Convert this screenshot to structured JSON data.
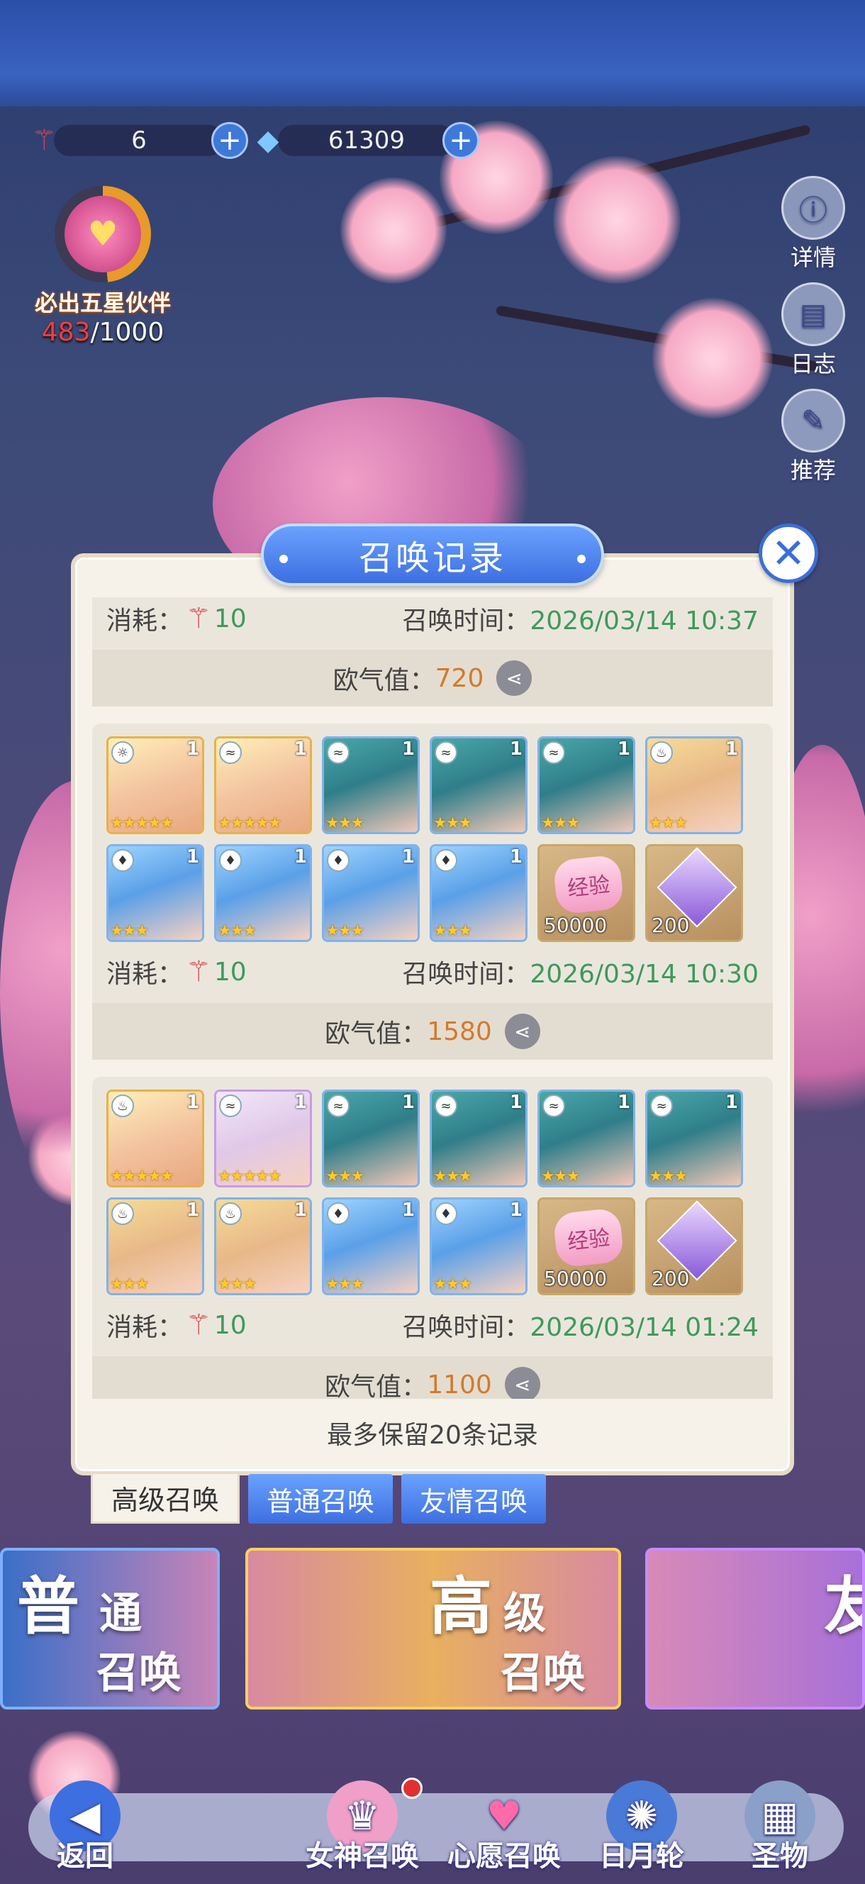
{
  "resources": {
    "summon_ticket": {
      "icon": "summon-wand-icon",
      "value": "6"
    },
    "crystal": {
      "icon": "crystal-icon",
      "value": "61309"
    }
  },
  "pity": {
    "label": "必出五星伙伴",
    "current": "483",
    "separator": "/",
    "total": "1000",
    "progress_fraction": 0.483
  },
  "side_menu": [
    {
      "label": "详情",
      "icon": "info-icon"
    },
    {
      "label": "日志",
      "icon": "book-icon"
    },
    {
      "label": "推荐",
      "icon": "feather-icon"
    }
  ],
  "modal": {
    "title": "召唤记录",
    "close_icon": "close-icon",
    "footer_note": "最多保留20条记录",
    "labels": {
      "cost": "消耗：",
      "time": "召唤时间：",
      "luck": "欧气值："
    },
    "records": [
      {
        "cost": "10",
        "time": "2026/03/14 10:37",
        "luck": "720",
        "cards": []
      },
      {
        "cost": "10",
        "time": "2026/03/14 10:30",
        "luck": "1580",
        "cards": [
          {
            "type": "hero",
            "count": "1",
            "stars": 5,
            "element": "light",
            "tone": "gold"
          },
          {
            "type": "hero",
            "count": "1",
            "stars": 5,
            "element": "wind",
            "tone": "gold"
          },
          {
            "type": "hero",
            "count": "1",
            "stars": 3,
            "element": "wind",
            "tone": "teal"
          },
          {
            "type": "hero",
            "count": "1",
            "stars": 3,
            "element": "wind",
            "tone": "teal"
          },
          {
            "type": "hero",
            "count": "1",
            "stars": 3,
            "element": "wind",
            "tone": "teal"
          },
          {
            "type": "hero",
            "count": "1",
            "stars": 3,
            "element": "fire",
            "tone": "blonde"
          },
          {
            "type": "hero",
            "count": "1",
            "stars": 3,
            "element": "water",
            "tone": "blue"
          },
          {
            "type": "hero",
            "count": "1",
            "stars": 3,
            "element": "water",
            "tone": "blue"
          },
          {
            "type": "hero",
            "count": "1",
            "stars": 3,
            "element": "water",
            "tone": "blue"
          },
          {
            "type": "hero",
            "count": "1",
            "stars": 3,
            "element": "water",
            "tone": "blue"
          },
          {
            "type": "exp",
            "label": "经验",
            "quantity": "50000"
          },
          {
            "type": "gem",
            "quantity": "200"
          }
        ]
      },
      {
        "cost": "10",
        "time": "2026/03/14 01:24",
        "luck": "1100",
        "cards": [
          {
            "type": "hero",
            "count": "1",
            "stars": 5,
            "element": "fire",
            "tone": "gold"
          },
          {
            "type": "hero",
            "count": "1",
            "stars": 5,
            "element": "wind",
            "tone": "pink"
          },
          {
            "type": "hero",
            "count": "1",
            "stars": 3,
            "element": "wind",
            "tone": "teal"
          },
          {
            "type": "hero",
            "count": "1",
            "stars": 3,
            "element": "wind",
            "tone": "teal"
          },
          {
            "type": "hero",
            "count": "1",
            "stars": 3,
            "element": "wind",
            "tone": "teal"
          },
          {
            "type": "hero",
            "count": "1",
            "stars": 3,
            "element": "wind",
            "tone": "teal"
          },
          {
            "type": "hero",
            "count": "1",
            "stars": 3,
            "element": "fire",
            "tone": "blonde"
          },
          {
            "type": "hero",
            "count": "1",
            "stars": 3,
            "element": "fire",
            "tone": "blonde"
          },
          {
            "type": "hero",
            "count": "1",
            "stars": 3,
            "element": "water",
            "tone": "blue"
          },
          {
            "type": "hero",
            "count": "1",
            "stars": 3,
            "element": "water",
            "tone": "blue"
          },
          {
            "type": "exp",
            "label": "经验",
            "quantity": "50000"
          },
          {
            "type": "gem",
            "quantity": "200"
          }
        ]
      }
    ]
  },
  "tabs": [
    {
      "label": "高级召唤",
      "active": true
    },
    {
      "label": "普通召唤",
      "active": false
    },
    {
      "label": "友情召唤",
      "active": false
    }
  ],
  "banners": [
    {
      "big": "普",
      "small1": "通",
      "small2": "召唤",
      "color": "#3e7fd8"
    },
    {
      "big": "高",
      "small1": "级",
      "small2": "召唤",
      "color": "#e8a52a"
    },
    {
      "big": "友",
      "color": "#9a5ad8"
    }
  ],
  "bottom_nav": [
    {
      "label": "返回",
      "icon": "back-arrow-icon"
    },
    {
      "label": "女神召唤",
      "icon": "goddess-icon",
      "badge": true
    },
    {
      "label": "心愿召唤",
      "icon": "heart-icon"
    },
    {
      "label": "日月轮",
      "icon": "compass-icon"
    },
    {
      "label": "圣物",
      "icon": "relic-icon"
    }
  ],
  "colors": {
    "accent_blue": "#3d6fe0",
    "luck_orange": "#d47a2a",
    "time_green": "#3d9a5c"
  }
}
